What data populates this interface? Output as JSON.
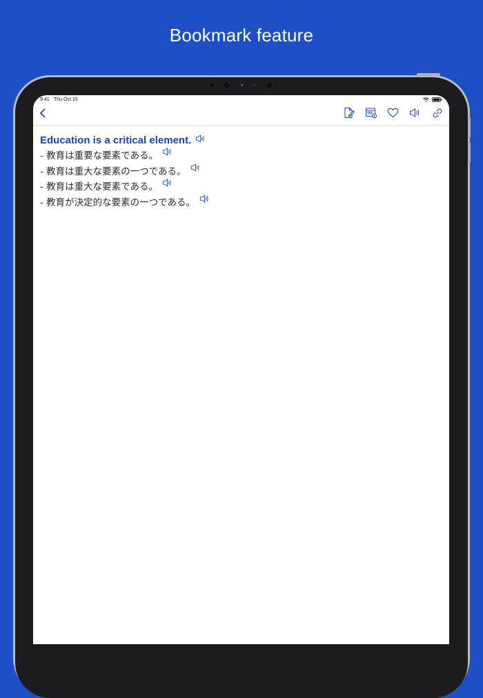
{
  "headline": "Bookmark feature",
  "status_bar": {
    "time": "9:41",
    "date": "Thu Oct 15"
  },
  "entry": {
    "title": "Education is a critical element.",
    "translations": [
      "- 教育は重要な要素である。",
      "- 教育は重大な要素の一つである。",
      "- 教育は重大な要素である。",
      "- 教育が決定的な要素の一つである。"
    ]
  },
  "colors": {
    "background": "#1e4fc7",
    "accent": "#1a3fbf",
    "text": "#2b2b2b"
  },
  "icons": {
    "back": "chevron-left-icon",
    "toolbar": [
      "edit-note-icon",
      "list-settings-icon",
      "heart-icon",
      "speaker-icon",
      "link-icon"
    ],
    "translation_audio": "speaker-icon"
  }
}
